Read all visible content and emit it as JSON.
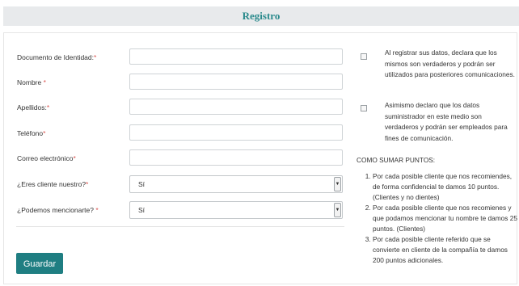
{
  "header": {
    "title": "Registro"
  },
  "form": {
    "fields": [
      {
        "label": "Documento de Identidad:",
        "required_mark": "*",
        "value": ""
      },
      {
        "label": "Nombre ",
        "required_mark": "*",
        "value": ""
      },
      {
        "label": "Apellidos:",
        "required_mark": "*",
        "value": ""
      },
      {
        "label": "Teléfono",
        "required_mark": "*",
        "value": ""
      },
      {
        "label": "Correo electrónico",
        "required_mark": "*",
        "value": ""
      }
    ],
    "selects": [
      {
        "label": "¿Eres cliente nuestro?",
        "required_mark": "*",
        "value": "Sí"
      },
      {
        "label": "¿Podemos mencionarte? ",
        "required_mark": "*",
        "value": "Sí"
      }
    ],
    "submit_label": "Guardar"
  },
  "consents": [
    {
      "text": "Al registrar sus datos, declara que los mismos son verdaderos y podrán ser utilizados para posteriores comunicaciones.",
      "checked": false
    },
    {
      "text": "Asimismo declaro que los datos suministrador en este medio son verdaderos y podrán ser empleados para fines de comunicación.",
      "checked": false
    }
  ],
  "points": {
    "heading": "COMO SUMAR PUNTOS:",
    "items": [
      "Por cada posible cliente que nos recomiendes, de forma confidencial te damos 10 puntos. (Clientes y no dientes)",
      "Por cada posible cliente que nos recomienes y que podamos mencionar tu nombre te damos 25 puntos. (Clientes)",
      "Por cada posible cliente referido que se convierte en cliente de la compañía te damos 200 puntos adicionales."
    ]
  }
}
